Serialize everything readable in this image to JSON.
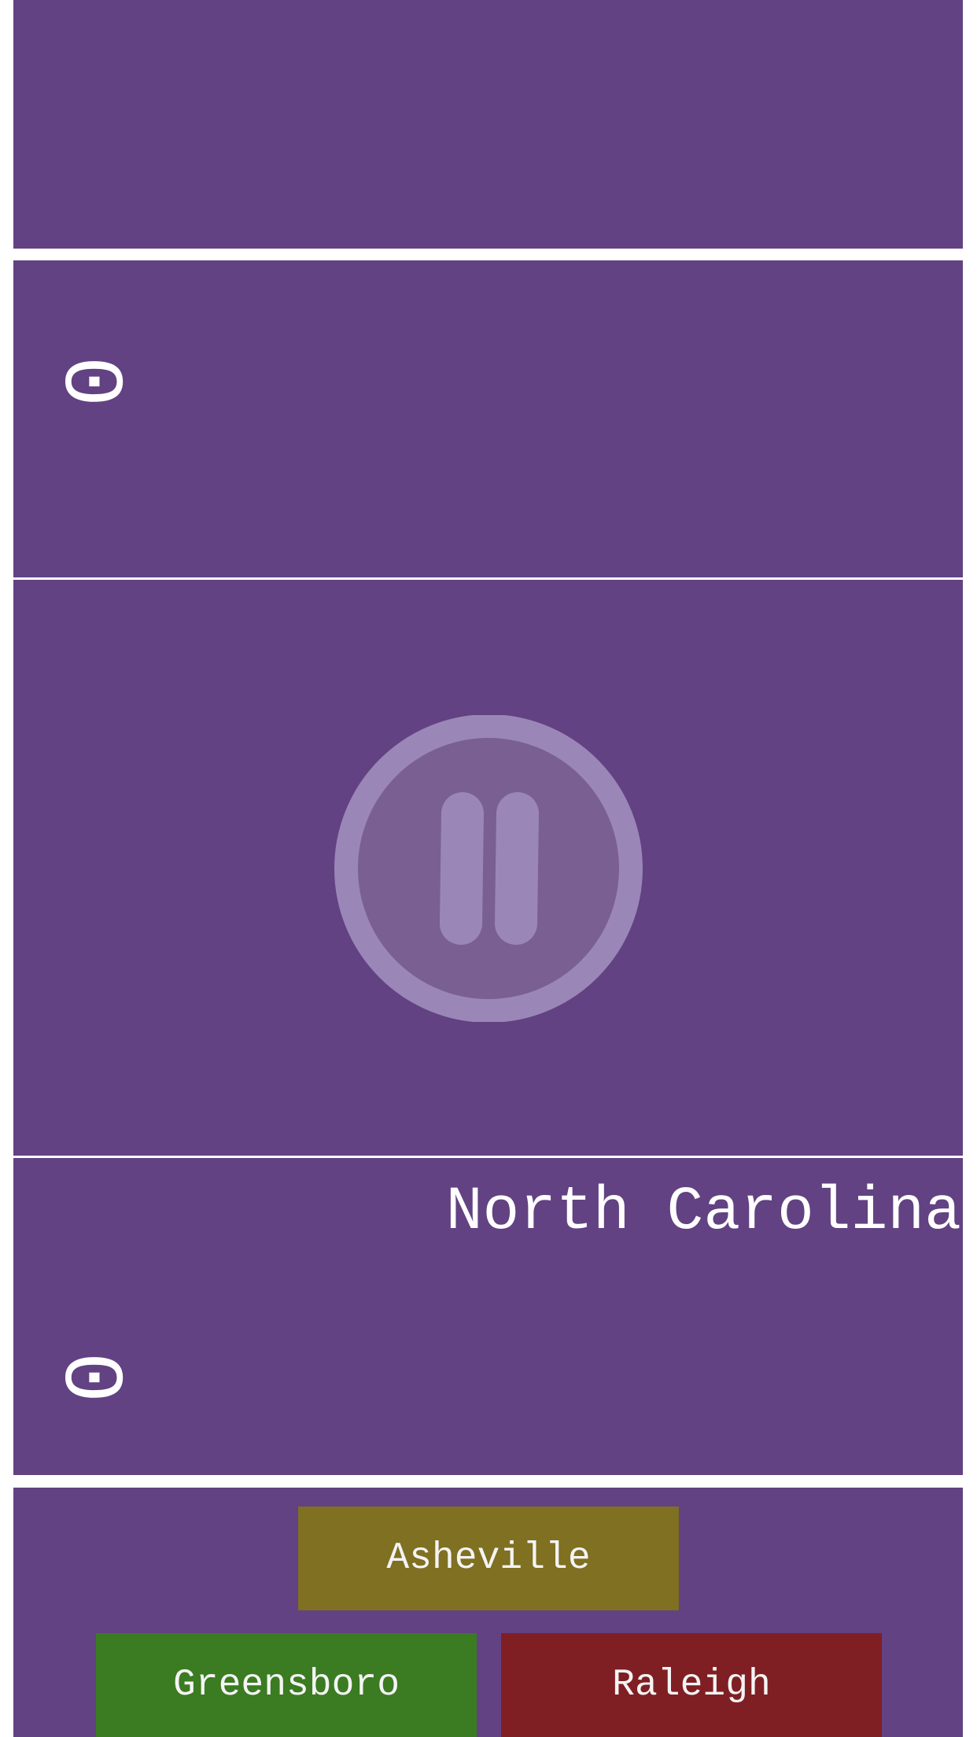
{
  "game": {
    "opponent_score": "0",
    "player_score": "0",
    "question": "North Carolina"
  },
  "answers": [
    {
      "label": "Asheville",
      "color": "#7f7022"
    },
    {
      "label": "Greensboro",
      "color": "#3b7b21"
    },
    {
      "label": "Raleigh",
      "color": "#7f1f23"
    }
  ],
  "colors": {
    "background": "#624282",
    "divider": "#ffffff",
    "pause_icon": "#9b86b8"
  },
  "icons": {
    "pause": "pause-icon"
  }
}
